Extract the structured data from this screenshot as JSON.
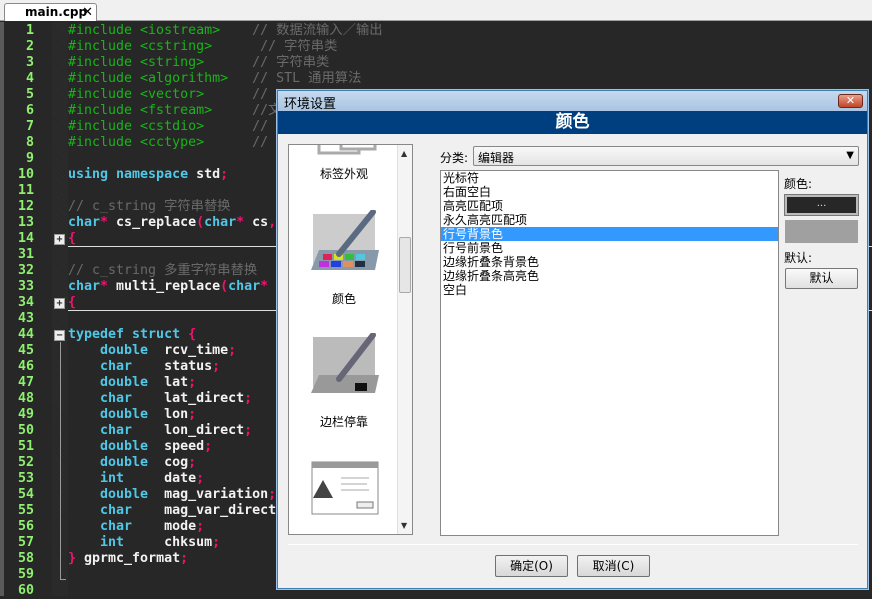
{
  "tab": {
    "title": "main.cpp",
    "close": "✕"
  },
  "code_lines": [
    {
      "n": "1",
      "t": [
        [
          "pp",
          "#include <iostream>"
        ],
        [
          "pp",
          "    "
        ],
        [
          "cm",
          "// 数据流输入／输出"
        ]
      ]
    },
    {
      "n": "2",
      "t": [
        [
          "pp",
          "#include <cstring>"
        ],
        [
          "pp",
          "      "
        ],
        [
          "cm",
          "// 字符串类"
        ]
      ]
    },
    {
      "n": "3",
      "t": [
        [
          "pp",
          "#include <string>"
        ],
        [
          "pp",
          "      "
        ],
        [
          "cm",
          "// 字符串类"
        ]
      ]
    },
    {
      "n": "4",
      "t": [
        [
          "pp",
          "#include <algorithm>"
        ],
        [
          "pp",
          "   "
        ],
        [
          "cm",
          "// STL 通用算法"
        ]
      ]
    },
    {
      "n": "5",
      "t": [
        [
          "pp",
          "#include <vector>"
        ],
        [
          "pp",
          "      "
        ],
        [
          "cm",
          "//"
        ]
      ]
    },
    {
      "n": "6",
      "t": [
        [
          "pp",
          "#include <fstream>"
        ],
        [
          "pp",
          "     "
        ],
        [
          "cm",
          "//文"
        ]
      ]
    },
    {
      "n": "7",
      "t": [
        [
          "pp",
          "#include <cstdio>"
        ],
        [
          "pp",
          "      "
        ],
        [
          "cm",
          "//"
        ]
      ]
    },
    {
      "n": "8",
      "t": [
        [
          "pp",
          "#include <cctype>"
        ],
        [
          "pp",
          "      "
        ],
        [
          "cm",
          "//"
        ]
      ]
    },
    {
      "n": "9",
      "t": []
    },
    {
      "n": "10",
      "t": [
        [
          "kw",
          "using namespace "
        ],
        [
          "id",
          "std"
        ],
        [
          "pu",
          ";"
        ]
      ]
    },
    {
      "n": "11",
      "t": []
    },
    {
      "n": "12",
      "t": [
        [
          "cm",
          "// c_string 字符串替换"
        ]
      ]
    },
    {
      "n": "13",
      "t": [
        [
          "kw",
          "char"
        ],
        [
          "pu",
          "*"
        ],
        [
          "id",
          " cs_replace"
        ],
        [
          "pu",
          "("
        ],
        [
          "kw",
          "char"
        ],
        [
          "pu",
          "*"
        ],
        [
          "id",
          " cs"
        ],
        [
          "pu",
          ","
        ]
      ],
      "sep": false
    },
    {
      "n": "14",
      "t": [
        [
          "pu",
          "{"
        ]
      ],
      "fold": "+",
      "sep": true
    },
    {
      "n": "31",
      "t": []
    },
    {
      "n": "32",
      "t": [
        [
          "cm",
          "// c_string 多重字符串替换"
        ]
      ]
    },
    {
      "n": "33",
      "t": [
        [
          "kw",
          "char"
        ],
        [
          "pu",
          "*"
        ],
        [
          "id",
          " multi_replace"
        ],
        [
          "pu",
          "("
        ],
        [
          "kw",
          "char"
        ],
        [
          "pu",
          "*"
        ]
      ]
    },
    {
      "n": "34",
      "t": [
        [
          "pu",
          "{"
        ]
      ],
      "fold": "+",
      "sep": true
    },
    {
      "n": "43",
      "t": []
    },
    {
      "n": "44",
      "t": [
        [
          "kw",
          "typedef struct "
        ],
        [
          "pu",
          "{"
        ]
      ],
      "fold": "−"
    },
    {
      "n": "45",
      "t": [
        [
          "kw",
          "    double  "
        ],
        [
          "id",
          "rcv_time"
        ],
        [
          "pu",
          ";"
        ]
      ]
    },
    {
      "n": "46",
      "t": [
        [
          "kw",
          "    char    "
        ],
        [
          "id",
          "status"
        ],
        [
          "pu",
          ";"
        ]
      ]
    },
    {
      "n": "47",
      "t": [
        [
          "kw",
          "    double  "
        ],
        [
          "id",
          "lat"
        ],
        [
          "pu",
          ";"
        ]
      ]
    },
    {
      "n": "48",
      "t": [
        [
          "kw",
          "    char    "
        ],
        [
          "id",
          "lat_direct"
        ],
        [
          "pu",
          ";"
        ]
      ]
    },
    {
      "n": "49",
      "t": [
        [
          "kw",
          "    double  "
        ],
        [
          "id",
          "lon"
        ],
        [
          "pu",
          ";"
        ]
      ]
    },
    {
      "n": "50",
      "t": [
        [
          "kw",
          "    char    "
        ],
        [
          "id",
          "lon_direct"
        ],
        [
          "pu",
          ";"
        ]
      ]
    },
    {
      "n": "51",
      "t": [
        [
          "kw",
          "    double  "
        ],
        [
          "id",
          "speed"
        ],
        [
          "pu",
          ";"
        ]
      ]
    },
    {
      "n": "52",
      "t": [
        [
          "kw",
          "    double  "
        ],
        [
          "id",
          "cog"
        ],
        [
          "pu",
          ";"
        ]
      ]
    },
    {
      "n": "53",
      "t": [
        [
          "kw",
          "    int     "
        ],
        [
          "id",
          "date"
        ],
        [
          "pu",
          ";"
        ]
      ]
    },
    {
      "n": "54",
      "t": [
        [
          "kw",
          "    double  "
        ],
        [
          "id",
          "mag_variation"
        ],
        [
          "pu",
          ";"
        ]
      ]
    },
    {
      "n": "55",
      "t": [
        [
          "kw",
          "    char    "
        ],
        [
          "id",
          "mag_var_direct"
        ]
      ]
    },
    {
      "n": "56",
      "t": [
        [
          "kw",
          "    char    "
        ],
        [
          "id",
          "mode"
        ],
        [
          "pu",
          ";"
        ]
      ]
    },
    {
      "n": "57",
      "t": [
        [
          "kw",
          "    int     "
        ],
        [
          "id",
          "chksum"
        ],
        [
          "pu",
          ";"
        ]
      ]
    },
    {
      "n": "58",
      "t": [
        [
          "pu",
          "}"
        ],
        [
          "id",
          " gprmc_format"
        ],
        [
          "pu",
          ";"
        ]
      ]
    },
    {
      "n": "59",
      "t": []
    },
    {
      "n": "60",
      "t": []
    }
  ],
  "dialog": {
    "title": "环境设置",
    "close": "✕",
    "header": "颜色",
    "left_items": [
      {
        "label": "标签外观"
      },
      {
        "label": "颜色"
      },
      {
        "label": "边栏停靠"
      }
    ],
    "category_label": "分类:",
    "category_value": "编辑器",
    "list": [
      "光标符",
      "右面空白",
      "高亮匹配项",
      "永久高亮匹配项",
      "行号背景色",
      "行号前景色",
      "边缘折叠条背景色",
      "边缘折叠条高亮色",
      "空白"
    ],
    "selected_index": 4,
    "color_label": "颜色:",
    "color_button": "...",
    "color_value": "#272727",
    "preview_color": "#a0a0a0",
    "default_label": "默认:",
    "default_button": "默认",
    "ok": "确定(O)",
    "cancel": "取消(C)"
  }
}
